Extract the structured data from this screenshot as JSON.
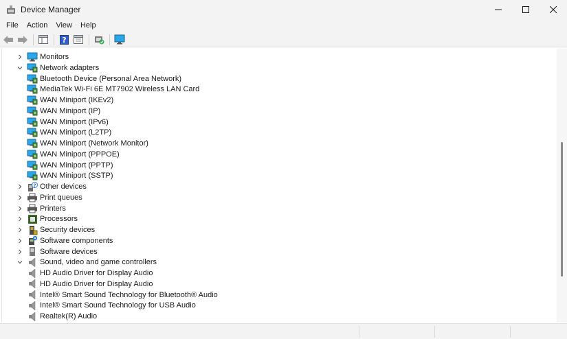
{
  "window": {
    "title": "Device Manager"
  },
  "menu": [
    "File",
    "Action",
    "View",
    "Help"
  ],
  "tree": [
    {
      "label": "Monitors",
      "depth": 0,
      "state": "collapsed",
      "icon": "monitor-icon"
    },
    {
      "label": "Network adapters",
      "depth": 0,
      "state": "expanded",
      "icon": "network-adapter-icon"
    },
    {
      "label": "Bluetooth Device (Personal Area Network)",
      "depth": 1,
      "icon": "network-adapter-icon"
    },
    {
      "label": "MediaTek Wi-Fi 6E MT7902 Wireless LAN Card",
      "depth": 1,
      "icon": "network-adapter-icon"
    },
    {
      "label": "WAN Miniport (IKEv2)",
      "depth": 1,
      "icon": "network-adapter-icon"
    },
    {
      "label": "WAN Miniport (IP)",
      "depth": 1,
      "icon": "network-adapter-icon"
    },
    {
      "label": "WAN Miniport (IPv6)",
      "depth": 1,
      "icon": "network-adapter-icon"
    },
    {
      "label": "WAN Miniport (L2TP)",
      "depth": 1,
      "icon": "network-adapter-icon"
    },
    {
      "label": "WAN Miniport (Network Monitor)",
      "depth": 1,
      "icon": "network-adapter-icon"
    },
    {
      "label": "WAN Miniport (PPPOE)",
      "depth": 1,
      "icon": "network-adapter-icon"
    },
    {
      "label": "WAN Miniport (PPTP)",
      "depth": 1,
      "icon": "network-adapter-icon"
    },
    {
      "label": "WAN Miniport (SSTP)",
      "depth": 1,
      "icon": "network-adapter-icon"
    },
    {
      "label": "Other devices",
      "depth": 0,
      "state": "collapsed",
      "icon": "unknown-device-icon"
    },
    {
      "label": "Print queues",
      "depth": 0,
      "state": "collapsed",
      "icon": "printer-icon"
    },
    {
      "label": "Printers",
      "depth": 0,
      "state": "collapsed",
      "icon": "printer-icon"
    },
    {
      "label": "Processors",
      "depth": 0,
      "state": "collapsed",
      "icon": "processor-icon"
    },
    {
      "label": "Security devices",
      "depth": 0,
      "state": "collapsed",
      "icon": "security-device-icon"
    },
    {
      "label": "Software components",
      "depth": 0,
      "state": "collapsed",
      "icon": "software-component-icon"
    },
    {
      "label": "Software devices",
      "depth": 0,
      "state": "collapsed",
      "icon": "software-device-icon"
    },
    {
      "label": "Sound, video and game controllers",
      "depth": 0,
      "state": "expanded",
      "icon": "speaker-icon"
    },
    {
      "label": "HD Audio Driver for Display Audio",
      "depth": 1,
      "icon": "speaker-icon"
    },
    {
      "label": "HD Audio Driver for Display Audio",
      "depth": 1,
      "icon": "speaker-icon"
    },
    {
      "label": "Intel® Smart Sound Technology for Bluetooth® Audio",
      "depth": 1,
      "icon": "speaker-icon"
    },
    {
      "label": "Intel® Smart Sound Technology for USB Audio",
      "depth": 1,
      "icon": "speaker-icon"
    },
    {
      "label": "Realtek(R) Audio",
      "depth": 1,
      "icon": "speaker-icon"
    }
  ],
  "colors": {
    "accent_blue": "#2b7cd3",
    "monitor_screen": "#29a7e8",
    "titlebar_bg": "#f3f3f3"
  }
}
